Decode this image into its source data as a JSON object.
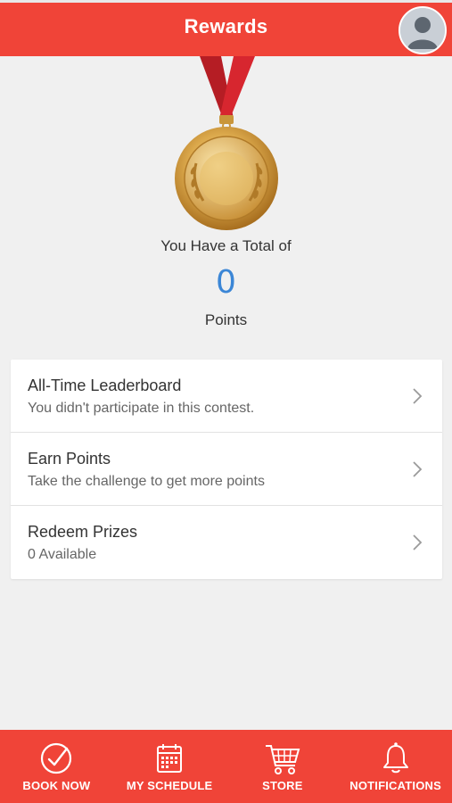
{
  "header": {
    "title": "Rewards"
  },
  "summary": {
    "total_label": "You Have a Total of",
    "points_value": "0",
    "points_unit": "Points"
  },
  "menu": [
    {
      "title": "All-Time Leaderboard",
      "subtitle": "You didn't participate in this contest."
    },
    {
      "title": "Earn Points",
      "subtitle": "Take the challenge to get more points"
    },
    {
      "title": "Redeem Prizes",
      "subtitle": "0 Available"
    }
  ],
  "tabs": [
    {
      "label": "BOOK NOW",
      "icon": "check-circle-icon"
    },
    {
      "label": "MY SCHEDULE",
      "icon": "calendar-icon"
    },
    {
      "label": "STORE",
      "icon": "cart-icon"
    },
    {
      "label": "NOTIFICATIONS",
      "icon": "bell-icon"
    }
  ],
  "colors": {
    "brand": "#f04438",
    "points": "#3b86d6"
  }
}
